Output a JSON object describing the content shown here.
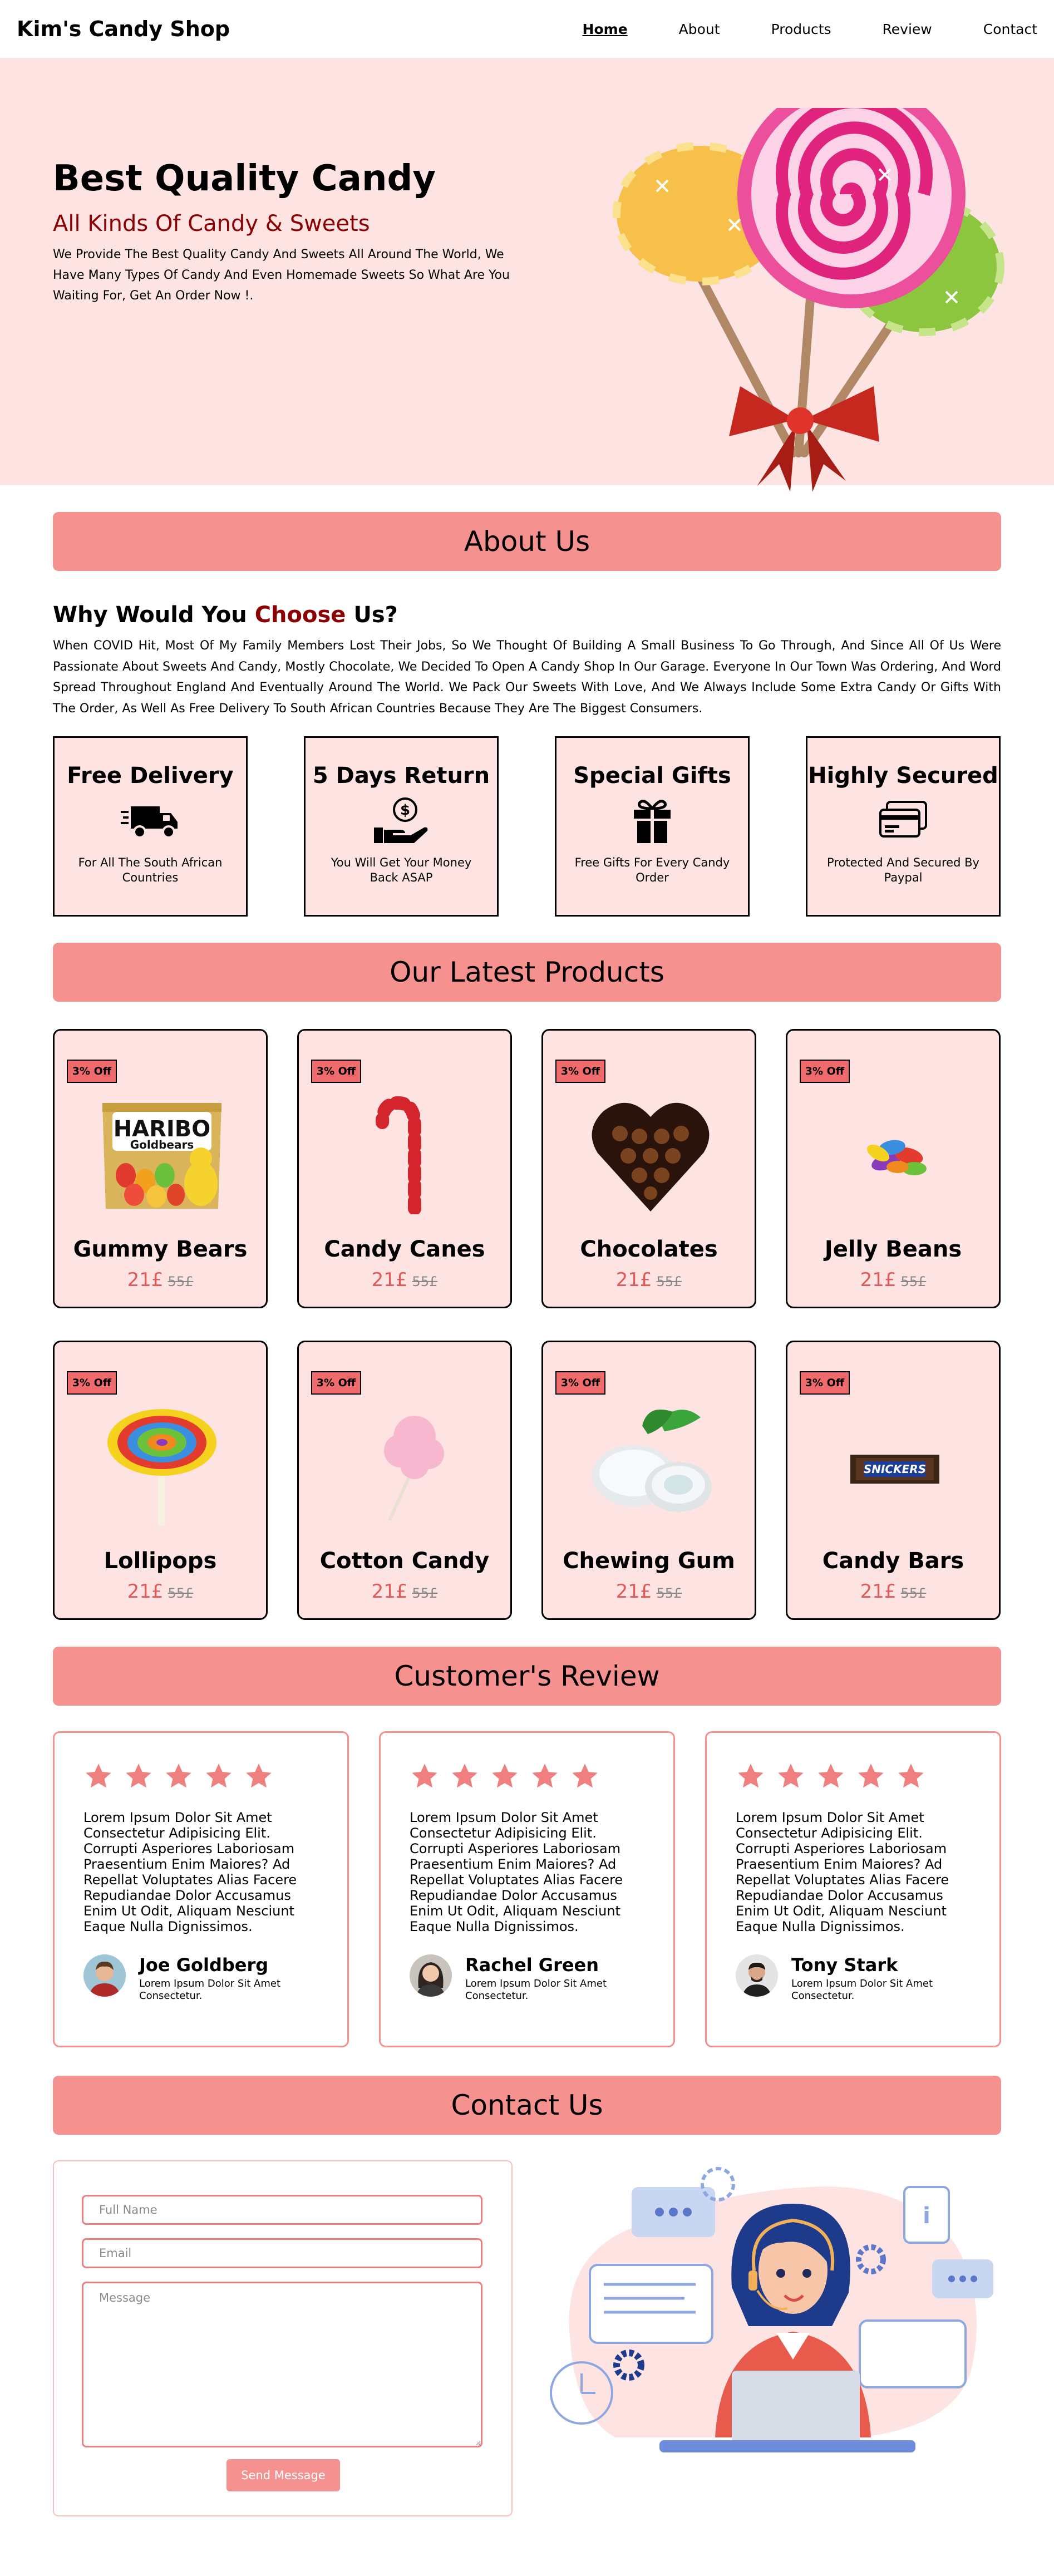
{
  "nav": {
    "brand": "Kim's Candy Shop",
    "links": [
      "Home",
      "About",
      "Products",
      "Review",
      "Contact"
    ]
  },
  "hero": {
    "title": "Best Quality Candy",
    "subtitle": "All Kinds Of Candy & Sweets",
    "text": "We Provide The Best Quality Candy And Sweets All Around The World, We Have Many Types Of Candy And Even Homemade Sweets So What Are You Waiting For, Get An Order Now !."
  },
  "about": {
    "heading": "About Us",
    "why_prefix": "Why Would You ",
    "why_accent": "Choose",
    "why_suffix": " Us?",
    "text": "When COVID Hit, Most Of My Family Members Lost Their Jobs, So We Thought Of Building A Small Business To Go Through, And Since All Of Us Were Passionate About Sweets And Candy, Mostly Chocolate, We Decided To Open A Candy Shop In Our Garage. Everyone In Our Town Was Ordering, And Word Spread Throughout England And Eventually Around The World. We Pack Our Sweets With Love, And We Always Include Some Extra Candy Or Gifts With The Order, As Well As Free Delivery To South African Countries Because They Are The Biggest Consumers.",
    "features": [
      {
        "title": "Free Delivery",
        "icon": "truck-icon",
        "text": "For All The South African Countries"
      },
      {
        "title": "5 Days Return",
        "icon": "money-hand-icon",
        "text": "You Will Get Your Money Back ASAP"
      },
      {
        "title": "Special Gifts",
        "icon": "gift-icon",
        "text": "Free Gifts For Every Candy Order"
      },
      {
        "title": "Highly Secured",
        "icon": "credit-card-icon",
        "text": "Protected And Secured By Paypal"
      }
    ]
  },
  "products": {
    "heading": "Our Latest Products",
    "badge": "3% Off",
    "items": [
      {
        "name": "Gummy Bears",
        "price": "21£",
        "old_price": "55£"
      },
      {
        "name": "Candy Canes",
        "price": "21£",
        "old_price": "55£"
      },
      {
        "name": "Chocolates",
        "price": "21£",
        "old_price": "55£"
      },
      {
        "name": "Jelly Beans",
        "price": "21£",
        "old_price": "55£"
      },
      {
        "name": "Lollipops",
        "price": "21£",
        "old_price": "55£"
      },
      {
        "name": "Cotton Candy",
        "price": "21£",
        "old_price": "55£"
      },
      {
        "name": "Chewing Gum",
        "price": "21£",
        "old_price": "55£"
      },
      {
        "name": "Candy Bars",
        "price": "21£",
        "old_price": "55£"
      }
    ],
    "logo_texts": {
      "haribo": "HARIBO",
      "goldbears": "Goldbears",
      "snickers": "SNICKERS"
    }
  },
  "reviews": {
    "heading": "Customer's Review",
    "rating": 5,
    "items": [
      {
        "text": "Lorem Ipsum Dolor Sit Amet Consectetur Adipisicing Elit. Corrupti Asperiores Laboriosam Praesentium Enim Maiores? Ad Repellat Voluptates Alias Facere Repudiandae Dolor Accusamus Enim Ut Odit, Aliquam Nesciunt Eaque Nulla Dignissimos.",
        "name": "Joe Goldberg",
        "role": "Lorem Ipsum Dolor Sit Amet Consectetur."
      },
      {
        "text": "Lorem Ipsum Dolor Sit Amet Consectetur Adipisicing Elit. Corrupti Asperiores Laboriosam Praesentium Enim Maiores? Ad Repellat Voluptates Alias Facere Repudiandae Dolor Accusamus Enim Ut Odit, Aliquam Nesciunt Eaque Nulla Dignissimos.",
        "name": "Rachel Green",
        "role": "Lorem Ipsum Dolor Sit Amet Consectetur."
      },
      {
        "text": "Lorem Ipsum Dolor Sit Amet Consectetur Adipisicing Elit. Corrupti Asperiores Laboriosam Praesentium Enim Maiores? Ad Repellat Voluptates Alias Facere Repudiandae Dolor Accusamus Enim Ut Odit, Aliquam Nesciunt Eaque Nulla Dignissimos.",
        "name": "Tony Stark",
        "role": "Lorem Ipsum Dolor Sit Amet Consectetur."
      }
    ]
  },
  "contact": {
    "heading": "Contact Us",
    "name_placeholder": "Full Name",
    "email_placeholder": "Email",
    "message_placeholder": "Message",
    "send_label": "Send Message"
  },
  "colors": {
    "accent": "#f59290",
    "hero_bg": "#fde4e2",
    "dark_red": "#8b0000",
    "price": "#e05a5a",
    "badge": "#ef6b6b"
  }
}
